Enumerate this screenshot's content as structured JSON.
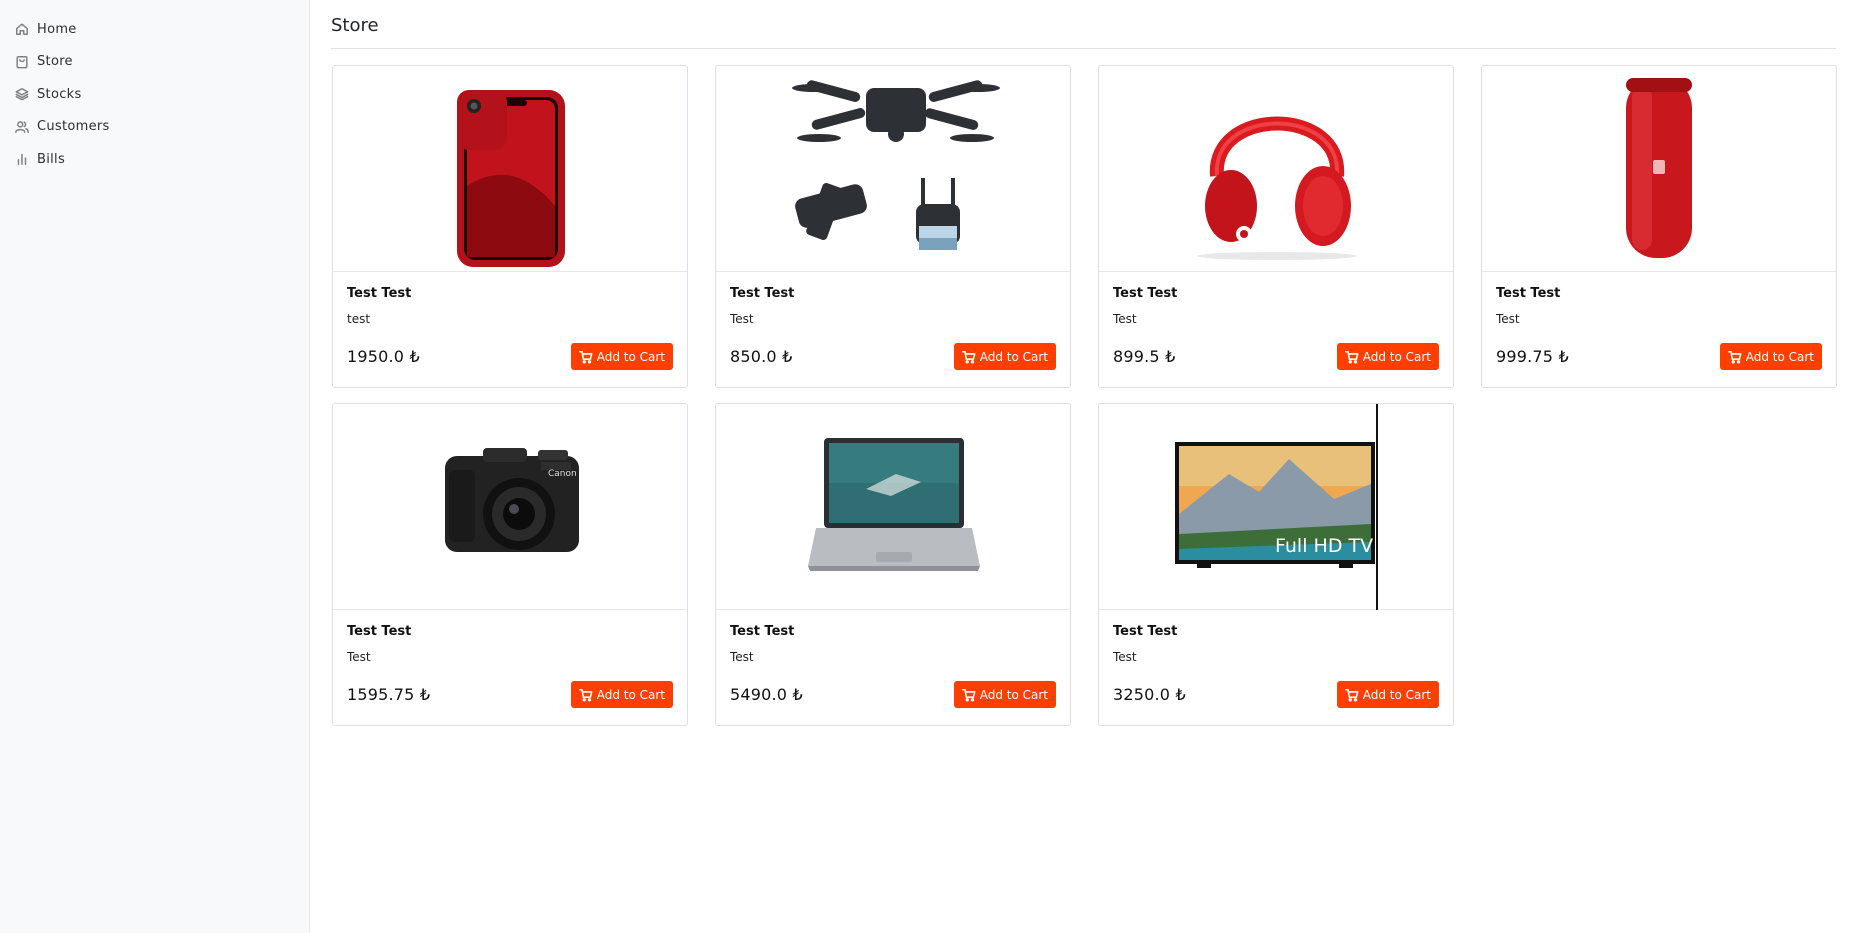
{
  "sidebar": {
    "items": [
      {
        "label": "Home",
        "icon": "home-icon"
      },
      {
        "label": "Store",
        "icon": "bag-icon"
      },
      {
        "label": "Stocks",
        "icon": "layers-icon"
      },
      {
        "label": "Customers",
        "icon": "users-icon"
      },
      {
        "label": "Bills",
        "icon": "bar-chart-icon"
      }
    ]
  },
  "page": {
    "title": "Store"
  },
  "colors": {
    "accent": "#ff3f00",
    "sidebar_bg": "#f8f9fa",
    "border": "#dcdfe3"
  },
  "products": [
    {
      "title": "Test Test",
      "description": "test",
      "price": "1950.0 ₺",
      "cart_label": "Add to Cart",
      "image": "red-smartphone"
    },
    {
      "title": "Test Test",
      "description": "Test",
      "price": "850.0 ₺",
      "cart_label": "Add to Cart",
      "image": "black-drone"
    },
    {
      "title": "Test Test",
      "description": "Test",
      "price": "899.5 ₺",
      "cart_label": "Add to Cart",
      "image": "red-headphones"
    },
    {
      "title": "Test Test",
      "description": "Test",
      "price": "999.75 ₺",
      "cart_label": "Add to Cart",
      "image": "red-speaker"
    },
    {
      "title": "Test Test",
      "description": "Test",
      "price": "1595.75 ₺",
      "cart_label": "Add to Cart",
      "image": "black-camera"
    },
    {
      "title": "Test Test",
      "description": "Test",
      "price": "5490.0 ₺",
      "cart_label": "Add to Cart",
      "image": "laptop"
    },
    {
      "title": "Test Test",
      "description": "Test",
      "price": "3250.0 ₺",
      "cart_label": "Add to Cart",
      "image": "tv",
      "image_text": "Full HD TV"
    }
  ]
}
